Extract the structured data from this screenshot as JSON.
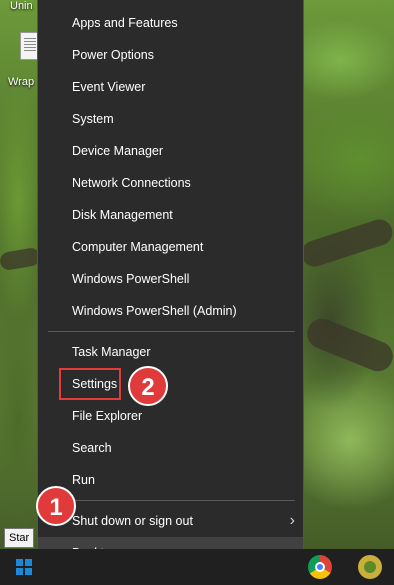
{
  "desktop": {
    "icon_label_top": "Unin",
    "icon_label_mid": "Wrap"
  },
  "menu": {
    "group1": [
      "Apps and Features",
      "Power Options",
      "Event Viewer",
      "System",
      "Device Manager",
      "Network Connections",
      "Disk Management",
      "Computer Management",
      "Windows PowerShell",
      "Windows PowerShell (Admin)"
    ],
    "group2": [
      "Task Manager",
      "Settings",
      "File Explorer",
      "Search",
      "Run"
    ],
    "group3": [
      "Shut down or sign out",
      "Desktop"
    ]
  },
  "annotations": {
    "step1": "1",
    "step2": "2",
    "highlight_color": "#e43c3c"
  },
  "taskbar": {
    "start_tooltip": "Star",
    "start_icon": "windows-logo-icon",
    "apps": [
      "chrome-icon",
      "app-icon"
    ]
  }
}
